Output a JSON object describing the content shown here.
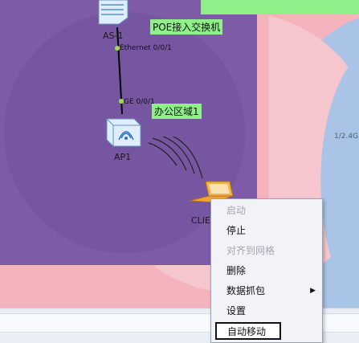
{
  "devices": {
    "switch": {
      "label": "AS-1",
      "port_label": "Ethernet 0/0/1"
    },
    "ap": {
      "label": "AP1",
      "port_label": "GE 0/0/1"
    },
    "client": {
      "label": "CLIE"
    }
  },
  "notes": {
    "switch_note": "POE接入交换机",
    "ap_note": "办公区域1"
  },
  "wlan": {
    "ssid_label": "1/2.4G"
  },
  "context_menu": {
    "items": [
      {
        "label": "启动",
        "enabled": false
      },
      {
        "label": "停止",
        "enabled": true
      },
      {
        "label": "对齐到网格",
        "enabled": false
      },
      {
        "label": "删除",
        "enabled": true
      },
      {
        "label": "数据抓包",
        "enabled": true,
        "submenu": true
      },
      {
        "label": "设置",
        "enabled": true
      },
      {
        "label": "自动移动",
        "enabled": true,
        "focused": true
      }
    ]
  },
  "colors": {
    "coverage_purple": "#7d5ba6",
    "coverage_blue": "#a9c4e6",
    "background_pink": "#f4b3bd",
    "note_green": "#8ff08a"
  },
  "icons": {
    "switch": "switch-icon",
    "ap": "access-point-icon",
    "client": "laptop-icon",
    "signal": "wireless-signal-icon",
    "submenu": "chevron-right-icon"
  }
}
